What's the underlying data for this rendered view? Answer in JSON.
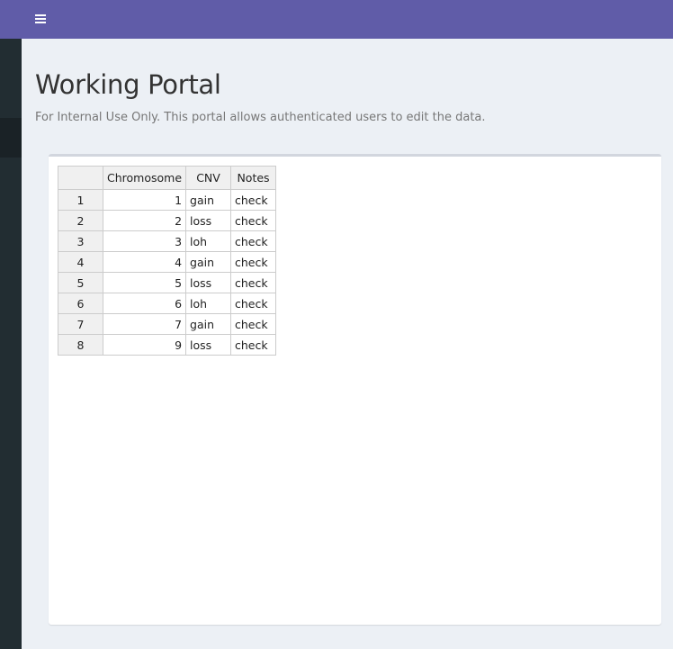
{
  "header": {
    "menu_icon": "hamburger-icon",
    "accent_color": "#605ca8"
  },
  "sidebar": {
    "color": "#222d32"
  },
  "page": {
    "title": "Working Portal",
    "subtitle": "For Internal Use Only. This portal allows authenticated users to edit the data."
  },
  "table": {
    "columns": [
      "Chromosome",
      "CNV",
      "Notes"
    ],
    "rows": [
      {
        "index": "1",
        "chromosome": "1",
        "cnv": "gain",
        "notes": "check"
      },
      {
        "index": "2",
        "chromosome": "2",
        "cnv": "loss",
        "notes": "check"
      },
      {
        "index": "3",
        "chromosome": "3",
        "cnv": "loh",
        "notes": "check"
      },
      {
        "index": "4",
        "chromosome": "4",
        "cnv": "gain",
        "notes": "check"
      },
      {
        "index": "5",
        "chromosome": "5",
        "cnv": "loss",
        "notes": "check"
      },
      {
        "index": "6",
        "chromosome": "6",
        "cnv": "loh",
        "notes": "check"
      },
      {
        "index": "7",
        "chromosome": "7",
        "cnv": "gain",
        "notes": "check"
      },
      {
        "index": "8",
        "chromosome": "9",
        "cnv": "loss",
        "notes": "check"
      }
    ]
  }
}
